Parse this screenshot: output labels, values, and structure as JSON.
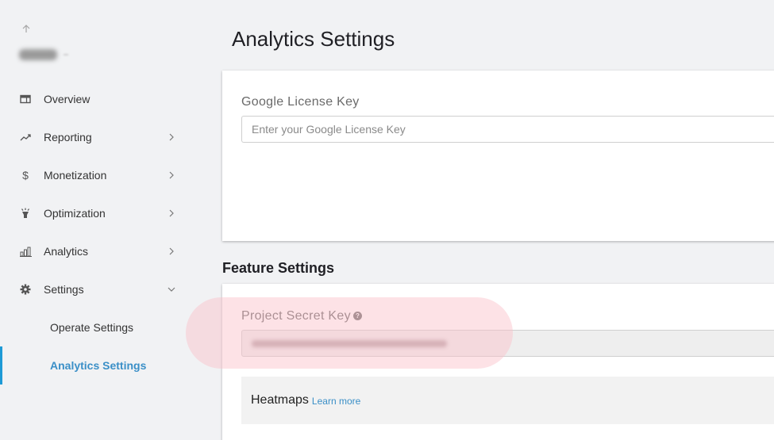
{
  "sidebar": {
    "back_icon": "arrow-up-icon",
    "account_name_obscured": true,
    "items": [
      {
        "label": "Overview",
        "icon": "overview-card-icon",
        "chevron": null
      },
      {
        "label": "Reporting",
        "icon": "trending-up-icon",
        "chevron": "chevron-right"
      },
      {
        "label": "Monetization",
        "icon": "dollar-icon",
        "chevron": "chevron-right"
      },
      {
        "label": "Optimization",
        "icon": "lamp-icon",
        "chevron": "chevron-right"
      },
      {
        "label": "Analytics",
        "icon": "bar-chart-icon",
        "chevron": "chevron-right"
      },
      {
        "label": "Settings",
        "icon": "gear-icon",
        "chevron": "chevron-down"
      }
    ],
    "sub_items": [
      {
        "label": "Operate Settings",
        "active": false
      },
      {
        "label": "Analytics Settings",
        "active": true
      }
    ]
  },
  "main": {
    "title": "Analytics Settings",
    "license_card": {
      "label": "Google License Key",
      "input_value": "",
      "input_placeholder": "Enter your Google License Key"
    },
    "feature_section": {
      "heading": "Feature Settings",
      "secret_key_label": "Project Secret Key",
      "secret_key_help_icon": "help-circle-icon",
      "secret_key_value_obscured": true,
      "heatmaps": {
        "title": "Heatmaps",
        "link_label": "Learn more"
      }
    }
  },
  "colors": {
    "accent": "#3a8fc7",
    "active_indicator": "#1e9ad6",
    "background": "#f1f2f4",
    "highlight": "#fbd3da"
  }
}
